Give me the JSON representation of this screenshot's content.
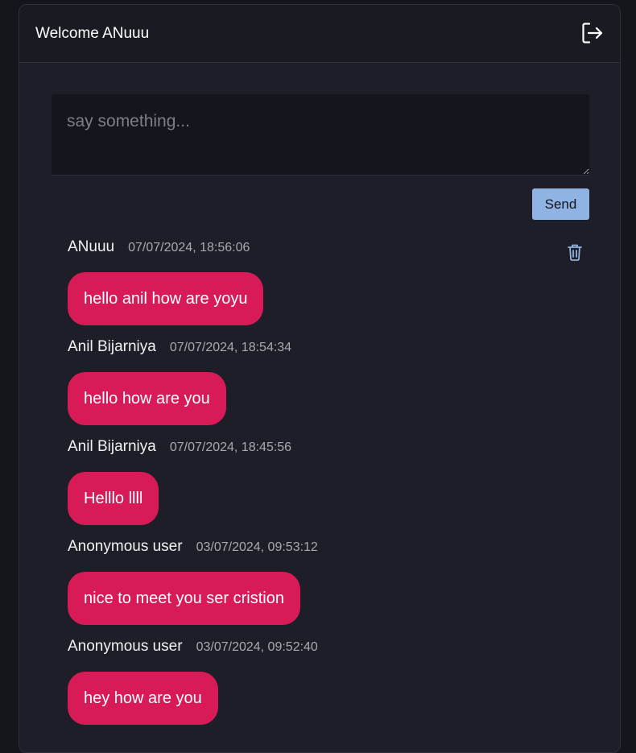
{
  "header": {
    "title": "Welcome ANuuu",
    "logout_icon": "logout-icon"
  },
  "compose": {
    "placeholder": "say something...",
    "value": "",
    "send_label": "Send"
  },
  "messages": [
    {
      "author": "ANuuu",
      "timestamp": "07/07/2024, 18:56:06",
      "text": "hello anil how are yoyu",
      "deletable": true
    },
    {
      "author": "Anil Bijarniya",
      "timestamp": "07/07/2024, 18:54:34",
      "text": "hello how are you",
      "deletable": false
    },
    {
      "author": "Anil Bijarniya",
      "timestamp": "07/07/2024, 18:45:56",
      "text": "Helllo llll",
      "deletable": false
    },
    {
      "author": "Anonymous user",
      "timestamp": "03/07/2024, 09:53:12",
      "text": "nice to meet you ser cristion",
      "deletable": false
    },
    {
      "author": "Anonymous user",
      "timestamp": "03/07/2024, 09:52:40",
      "text": "hey how are you",
      "deletable": false
    }
  ],
  "colors": {
    "background": "#15161c",
    "panel": "#1d1e28",
    "bubble": "#d81b57",
    "send_button": "#8fb3e3",
    "delete_icon": "#8fb3e3"
  }
}
